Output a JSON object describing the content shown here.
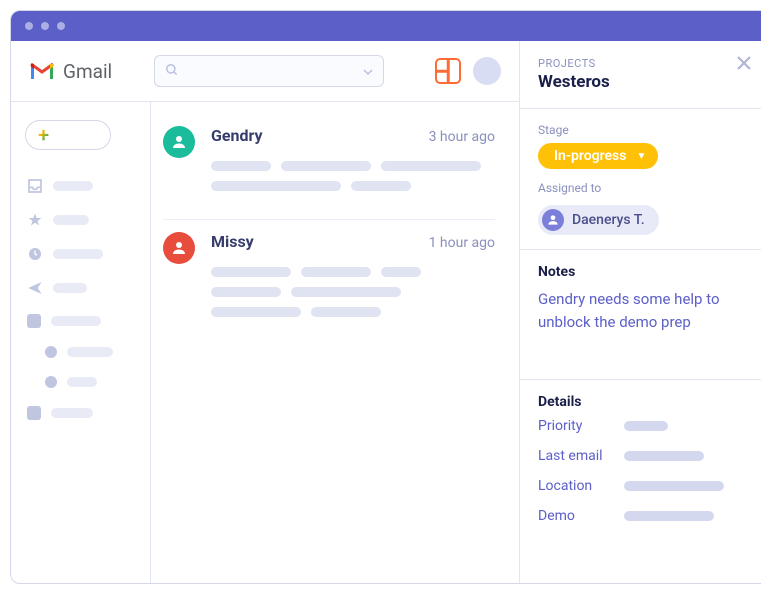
{
  "brand": {
    "name": "Gmail"
  },
  "search": {
    "placeholder": ""
  },
  "emails": [
    {
      "sender": "Gendry",
      "time": "3 hour ago",
      "avatar_color": "#1abc9c"
    },
    {
      "sender": "Missy",
      "time": "1 hour ago",
      "avatar_color": "#e74c3c"
    }
  ],
  "panel": {
    "section_label": "PROJECTS",
    "title": "Westeros",
    "stage_label": "Stage",
    "stage_value": "In-progress",
    "assigned_label": "Assigned to",
    "assignee": "Daenerys T.",
    "notes_label": "Notes",
    "notes_text": "Gendry needs some help to unblock the demo prep",
    "details_label": "Details",
    "details": [
      {
        "label": "Priority"
      },
      {
        "label": "Last email"
      },
      {
        "label": "Location"
      },
      {
        "label": "Demo"
      }
    ]
  }
}
